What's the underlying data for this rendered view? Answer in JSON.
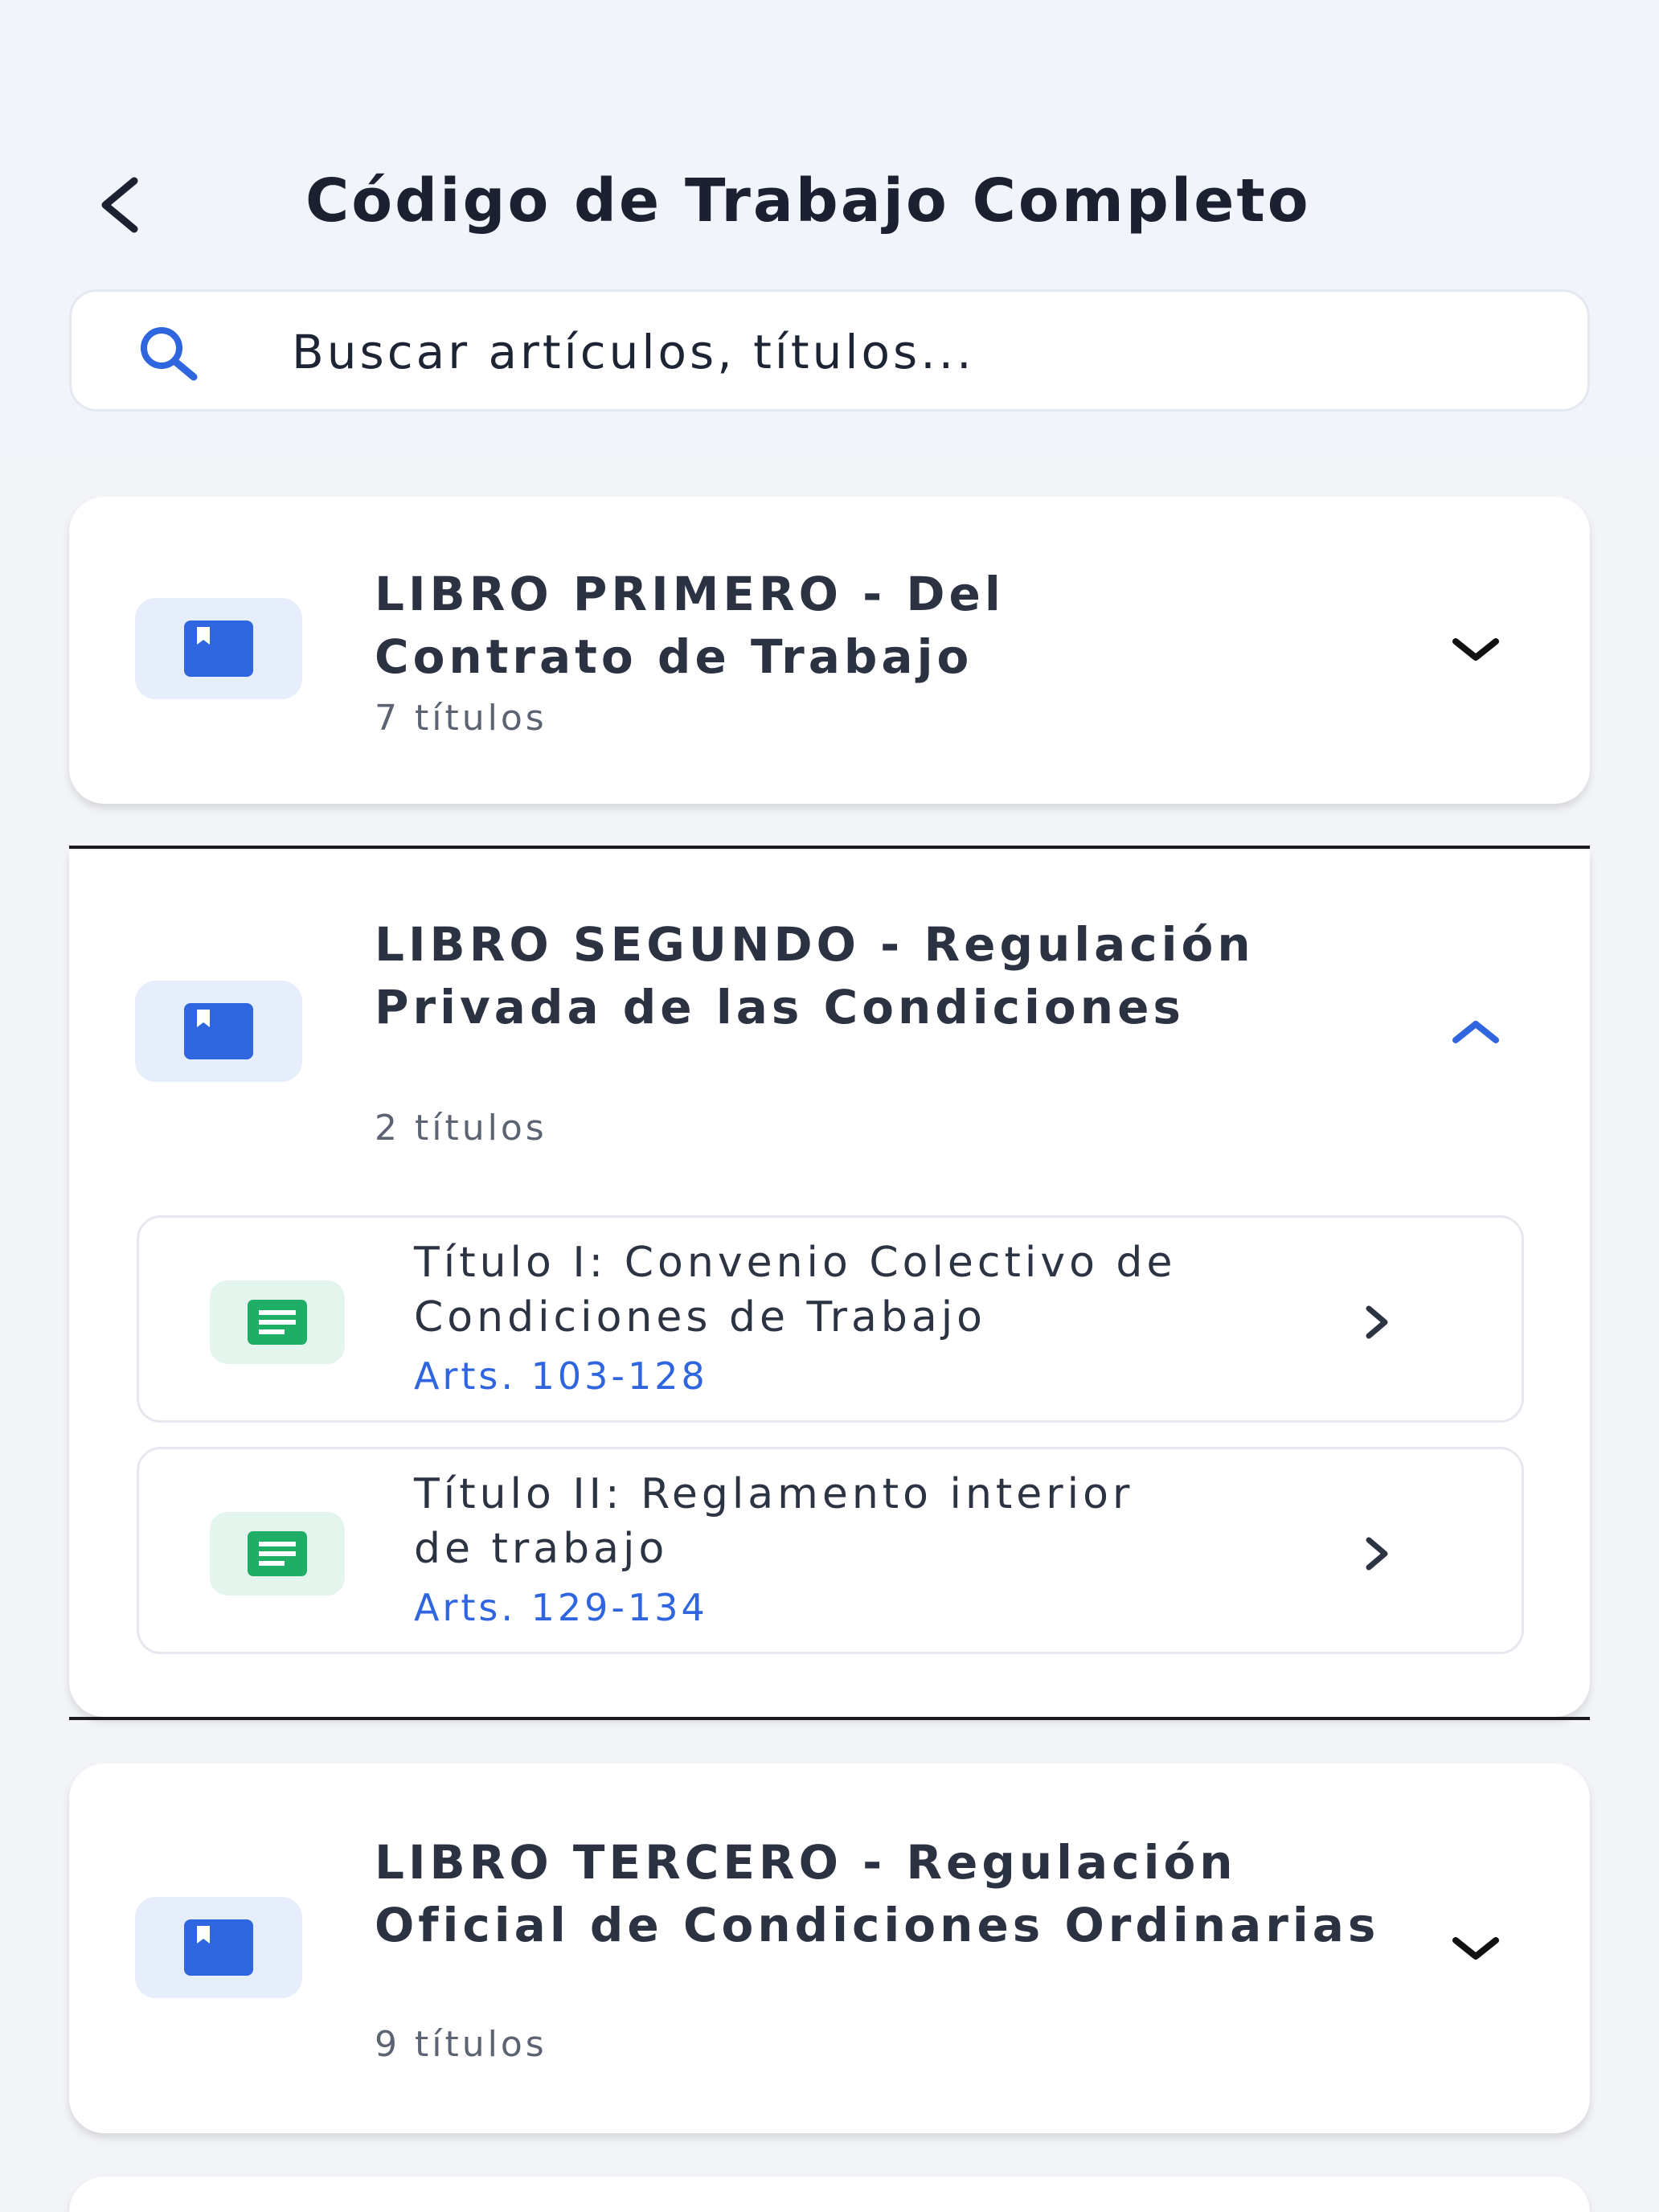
{
  "header": {
    "title": "Código de Trabajo Completo",
    "back_icon": "chevron-left-icon"
  },
  "search": {
    "placeholder": "Buscar artículos, títulos...",
    "icon": "search-icon"
  },
  "colors": {
    "accent": "#2f66e0",
    "book_icon": "#2f66e0",
    "doc_icon": "#1fae66"
  },
  "books": [
    {
      "title": "LIBRO PRIMERO - Del Contrato de Trabajo",
      "count": "7 títulos",
      "expanded": false
    },
    {
      "title": "LIBRO SEGUNDO - Regulación Privada de las Condiciones",
      "count": "2 títulos",
      "expanded": true,
      "items": [
        {
          "title": "Título I: Convenio Colectivo de Condiciones de Trabajo",
          "range": "Arts. 103-128"
        },
        {
          "title": "Título II: Reglamento interior de trabajo",
          "range": "Arts. 129-134"
        }
      ]
    },
    {
      "title": "LIBRO TERCERO - Regulación Oficial de Condiciones Ordinarias",
      "count": "9 títulos",
      "expanded": false
    }
  ]
}
